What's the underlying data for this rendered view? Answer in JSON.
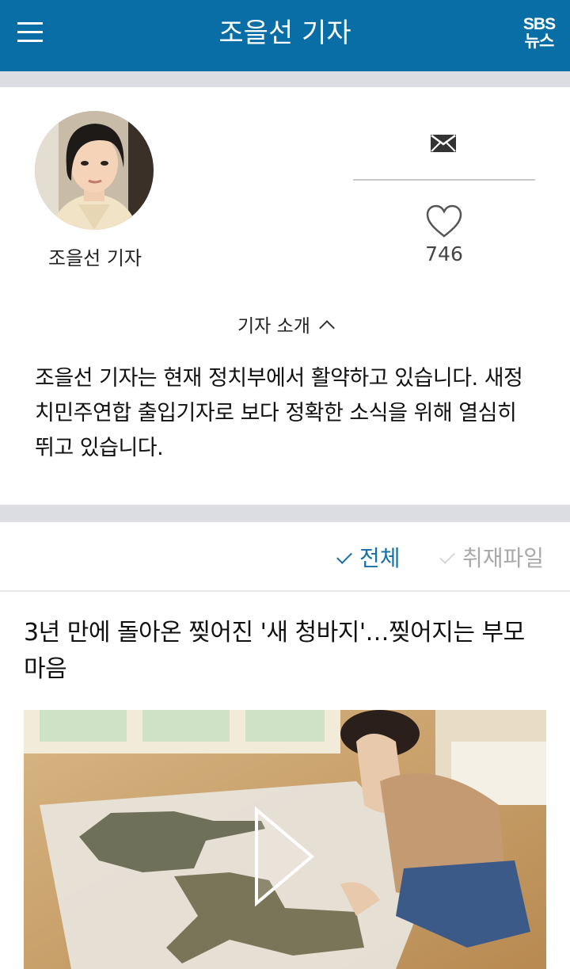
{
  "header": {
    "title": "조을선 기자",
    "brand_line1": "SBS",
    "brand_line2": "뉴스"
  },
  "profile": {
    "name": "조을선 기자",
    "like_count": "746",
    "intro_toggle_label": "기자 소개",
    "intro_text": "조을선 기자는 현재 정치부에서 활약하고 있습니다. 새정치민주연합 출입기자로 보다 정확한 소식을 위해 열심히 뛰고 있습니다."
  },
  "filters": [
    {
      "label": "전체",
      "active": true
    },
    {
      "label": "취재파일",
      "active": false
    }
  ],
  "articles": [
    {
      "title": "3년 만에 돌아온 찢어진 '새 청바지'…찢어지는 부모 마음",
      "has_video": true
    }
  ],
  "colors": {
    "header_bg": "#0a6ea6",
    "accent": "#1670a8",
    "section_gap": "#dcdde2",
    "inactive": "#a9a9a9"
  },
  "icons": [
    "menu-icon",
    "mail-icon",
    "heart-icon",
    "chevron-up-icon",
    "check-icon",
    "play-icon"
  ]
}
